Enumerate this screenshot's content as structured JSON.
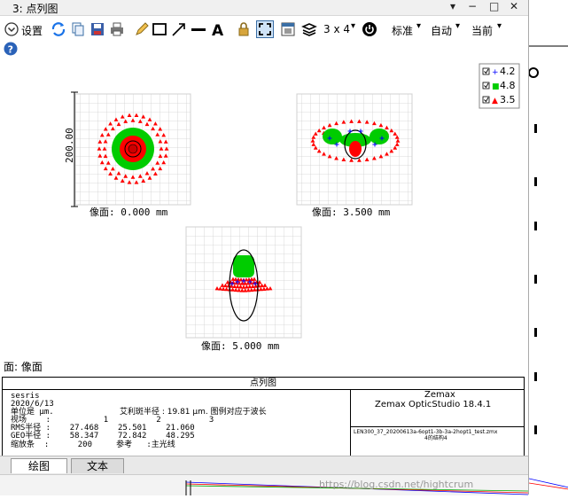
{
  "window": {
    "title": "3: 点列图",
    "controls": [
      "▾",
      "−",
      "□",
      "✕"
    ]
  },
  "toolbar": {
    "settings_label": "设置",
    "layout_label": "3 x 4",
    "standard_label": "标准",
    "auto_label": "自动",
    "current_label": "当前"
  },
  "legend": {
    "items": [
      {
        "label": "4.2",
        "color": "#0000ff",
        "marker": "+"
      },
      {
        "label": "4.8",
        "color": "#00cc00",
        "marker": "■"
      },
      {
        "label": "3.5",
        "color": "#ff0000",
        "marker": "▲"
      }
    ]
  },
  "plots": {
    "scale_label": "200.00",
    "fields": [
      {
        "label": "像面: 0.000 mm"
      },
      {
        "label": "像面: 3.500 mm"
      },
      {
        "label": "像面: 5.000 mm"
      }
    ],
    "surface_label": "面: 像面"
  },
  "info": {
    "header": "点列图",
    "lines": [
      "sesris",
      "2020/6/13",
      "单位是 μm.",
      "视场    :           1          2          3",
      "RMS半径 :    27.468    25.501    21.060",
      "GEO半径 :    58.347    72.842    48.295",
      "缩放条  :      200     参考   :主光线"
    ],
    "airy_text": "艾利斑半径 : 19.81 μm. 图例对应于波长",
    "right_title": "Zemax",
    "right_version": "Zemax OpticStudio 18.4.1",
    "file_name": "LEN300_37_20200613a-6opt1-3b-3a-2hopt1_test.zmx",
    "config_label": "4的结构4"
  },
  "tabs": [
    {
      "label": "绘图",
      "active": true
    },
    {
      "label": "文本",
      "active": false
    }
  ],
  "watermark": "https://blog.csdn.net/hightcrum",
  "colors": {
    "blue": "#0000ff",
    "green": "#00cc00",
    "red": "#ff0000",
    "grid": "#d0d0d0"
  }
}
